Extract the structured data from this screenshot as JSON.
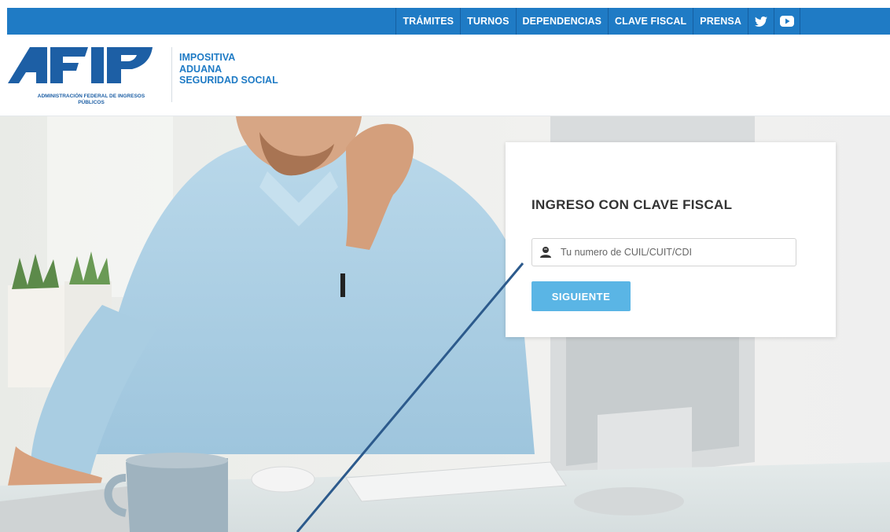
{
  "nav": {
    "items": [
      "TRÁMITES",
      "TURNOS",
      "DEPENDENCIAS",
      "CLAVE FISCAL",
      "PRENSA"
    ],
    "icons": [
      "twitter-icon",
      "youtube-icon"
    ]
  },
  "brand": {
    "logo_text": "ADMINISTRACIÓN FEDERAL DE INGRESOS PÚBLICOS",
    "categories": [
      "IMPOSITIVA",
      "ADUANA",
      "SEGURIDAD SOCIAL"
    ]
  },
  "login": {
    "title": "INGRESO CON CLAVE FISCAL",
    "placeholder": "Tu numero de CUIL/CUIT/CDI",
    "button": "SIGUIENTE",
    "icon": "user-icon"
  },
  "colors": {
    "bar": "#1f7bc5",
    "brand": "#1f7bc5",
    "button": "#5ab5e5",
    "annotation_line": "#2c5a8c"
  }
}
